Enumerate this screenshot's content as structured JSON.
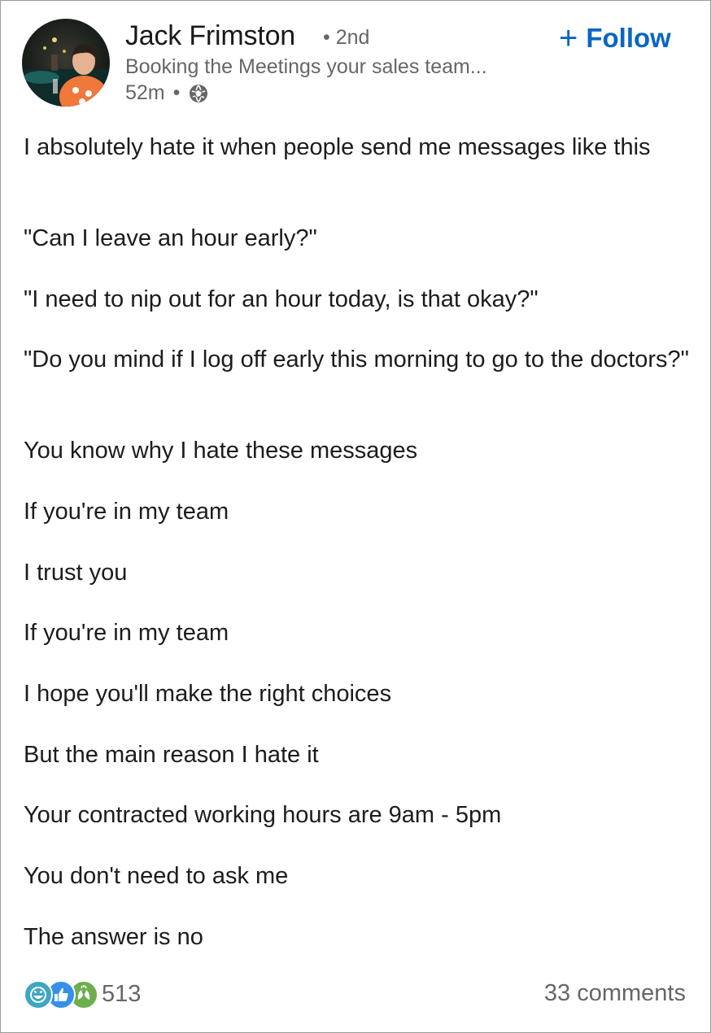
{
  "author": {
    "name": "Jack Frimston",
    "degree": "• 2nd",
    "headline": "Booking the Meetings your sales team...",
    "time": "52m",
    "visibility_icon": "globe-icon"
  },
  "follow_button": {
    "plus": "+",
    "label": "Follow"
  },
  "post": {
    "paragraphs": [
      "I absolutely hate it when people send me messages like this",
      "\"Can I leave an hour early?\"",
      "\"I need to nip out for an hour today, is that okay?\"",
      "\"Do you mind if I log off early this morning to go to the doctors?\"",
      "You know why I hate these messages",
      "If you're in my team",
      "I trust you",
      "If you're in my team",
      "I hope you'll make the right choices",
      "But the main reason I hate it",
      "Your contracted working hours are 9am - 5pm",
      "You don't need to ask me",
      "The answer is no"
    ]
  },
  "social": {
    "reaction_icons": [
      "funny-icon",
      "like-icon",
      "celebrate-icon"
    ],
    "reaction_count": "513",
    "comments": "33 comments"
  },
  "colors": {
    "brand_blue": "#0a66c2",
    "secondary_text": "#666666",
    "funny": "#3da6c4",
    "like": "#378fe9",
    "celebrate": "#6dae4f"
  }
}
